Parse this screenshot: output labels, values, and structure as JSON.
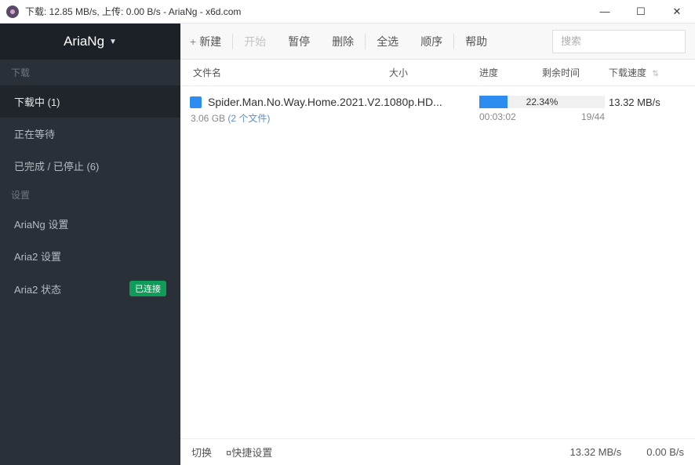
{
  "window": {
    "title": "下载: 12.85 MB/s, 上传: 0.00 B/s - AriaNg - x6d.com"
  },
  "brand": "AriaNg",
  "sidebar": {
    "section_downloads": "下载",
    "items_dl": [
      {
        "label": "下载中 (1)",
        "active": true
      },
      {
        "label": "正在等待"
      },
      {
        "label": "已完成 / 已停止 (6)"
      }
    ],
    "section_settings": "设置",
    "items_set": [
      {
        "label": "AriaNg 设置"
      },
      {
        "label": "Aria2 设置"
      },
      {
        "label": "Aria2 状态",
        "badge": "已连接"
      }
    ]
  },
  "toolbar": {
    "new": "新建",
    "start": "开始",
    "pause": "暂停",
    "delete": "删除",
    "selectall": "全选",
    "order": "顺序",
    "help": "帮助",
    "search_placeholder": "搜索"
  },
  "columns": {
    "name": "文件名",
    "size": "大小",
    "progress": "进度",
    "remain": "剩余时间",
    "speed": "下载速度"
  },
  "task": {
    "filename": "Spider.Man.No.Way.Home.2021.V2.1080p.HD...",
    "size": "3.06 GB",
    "files": "(2 个文件)",
    "percent": "22.34%",
    "percent_val": 22.34,
    "eta": "00:03:02",
    "peers": "19/44",
    "speed": "13.32 MB/s"
  },
  "status": {
    "switch": "切换",
    "quick": "¤快捷设置",
    "dl": "13.32 MB/s",
    "ul": "0.00 B/s"
  }
}
